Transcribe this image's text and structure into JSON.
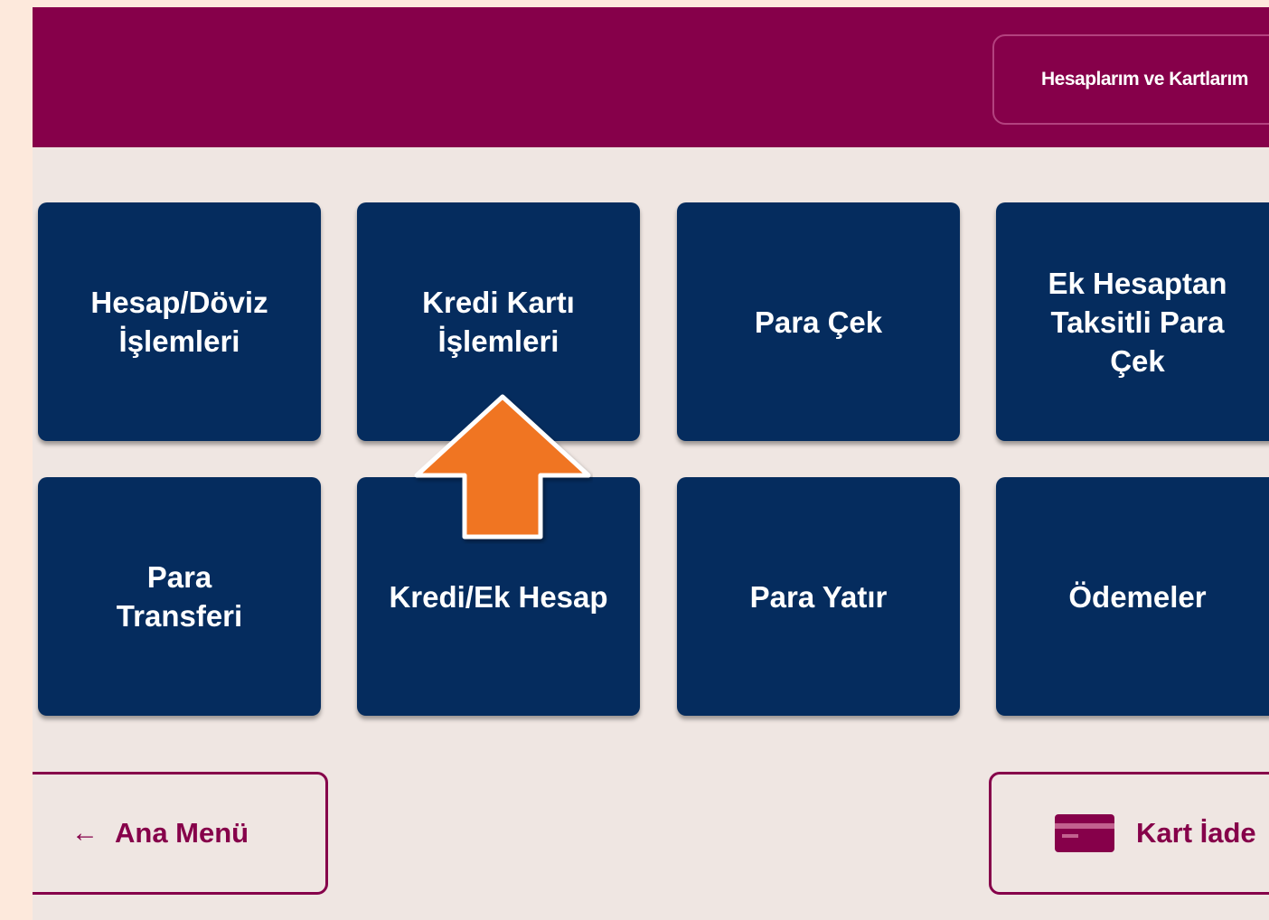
{
  "header": {
    "accounts_button_label": "Hesaplarım ve Kartlarım"
  },
  "tiles": [
    {
      "label": "Hesap/Döviz\nİşlemleri"
    },
    {
      "label": "Kredi Kartı\nİşlemleri"
    },
    {
      "label": "Para Çek"
    },
    {
      "label": "Ek Hesaptan\nTaksitli Para\nÇek"
    },
    {
      "label": "Para\nTransferi"
    },
    {
      "label": "Kredi/Ek Hesap"
    },
    {
      "label": "Para Yatır"
    },
    {
      "label": "Ödemeler"
    }
  ],
  "footer": {
    "back_label": "Ana Menü",
    "back_icon": "left-arrow-icon",
    "card_return_label": "Kart İade",
    "card_icon": "credit-card-icon"
  },
  "highlight": {
    "icon": "up-arrow-pointer-icon",
    "color": "#f07523",
    "target": "Kredi Kartı İşlemleri"
  },
  "colors": {
    "brand": "#86004a",
    "tile": "#052c5e",
    "background": "#efe6e2"
  }
}
